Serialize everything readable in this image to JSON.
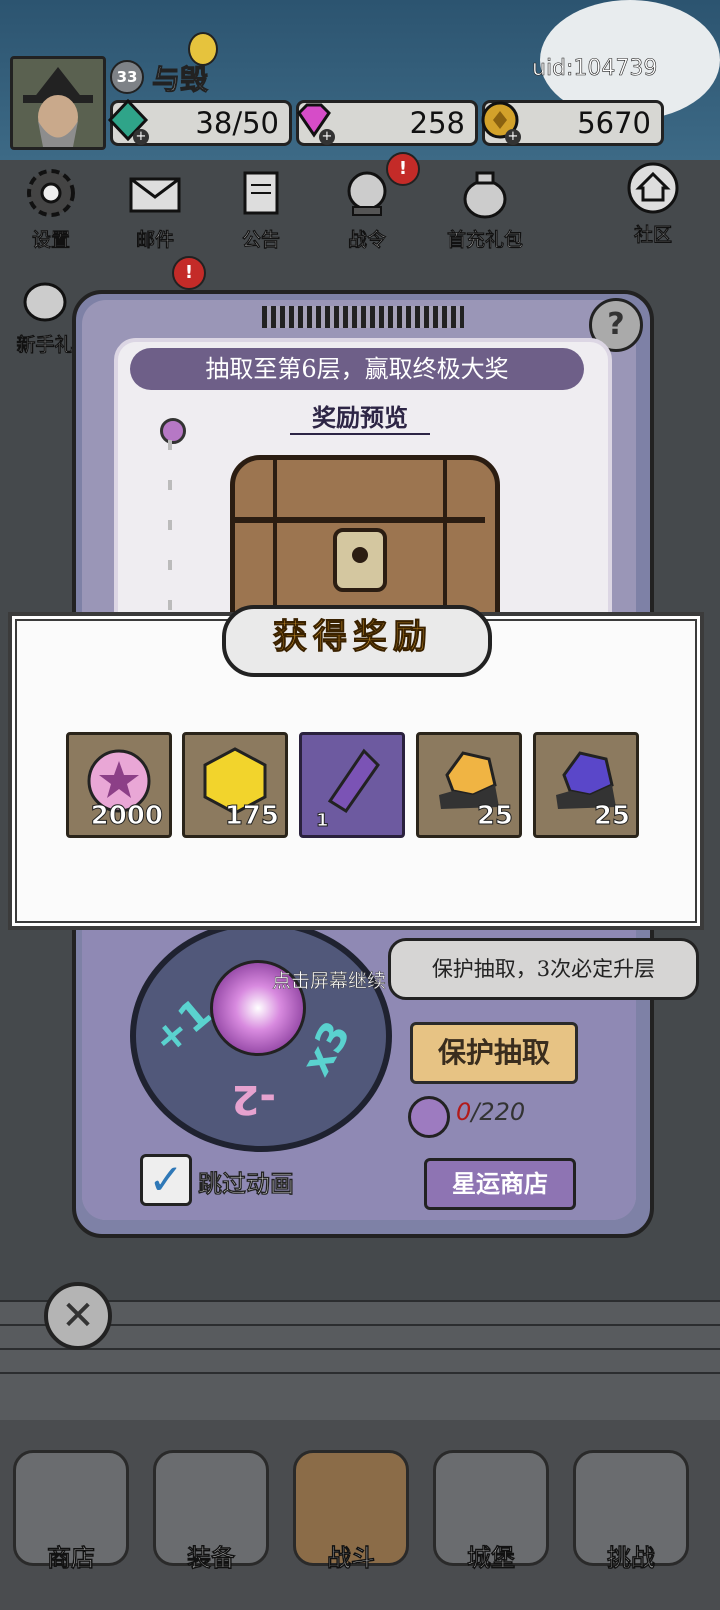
{
  "player": {
    "level": "33",
    "name": "与毁",
    "uid": "uid:104739"
  },
  "resources": [
    {
      "name": "energy",
      "icon": "green-crystal-icon",
      "value": "38/50"
    },
    {
      "name": "gems",
      "icon": "pink-diamond-icon",
      "value": "258"
    },
    {
      "name": "gold",
      "icon": "gold-coin-icon",
      "value": "5670"
    }
  ],
  "menu": {
    "settings": "设置",
    "mail": "邮件",
    "notice": "公告",
    "battle_pass": "战令",
    "first_recharge": "首充礼包",
    "community": "社区",
    "newbie": "新手礼"
  },
  "gacha": {
    "goal_text": "抽取至第6层，赢取终极大奖",
    "preview_title": "奖励预览",
    "tap_hint": "点击屏幕继续",
    "tip": "保护抽取，3次必定升层",
    "protect_button": "保护抽取",
    "cost_have": "0",
    "cost_need": "/220",
    "skip_label": "跳过动画",
    "shop_button": "星运商店"
  },
  "popup": {
    "title": "获得奖励",
    "rewards": [
      {
        "icon": "pink-star-coin-icon",
        "count": "2000"
      },
      {
        "icon": "yellow-gem-icon",
        "count": "175"
      },
      {
        "icon": "purple-crystal-shard-icon",
        "count": "1"
      },
      {
        "icon": "orange-ore-icon",
        "count": "25"
      },
      {
        "icon": "blue-ore-icon",
        "count": "25"
      }
    ]
  },
  "nav": {
    "shop": "商店",
    "equip": "装备",
    "battle": "战斗",
    "castle": "城堡",
    "challenge": "挑战"
  },
  "colors": {
    "popup_title": "#e8a834",
    "cost_zero": "#b21a1a",
    "check": "#2f78b7"
  }
}
